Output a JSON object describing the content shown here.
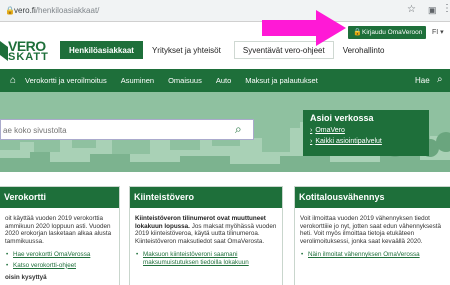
{
  "browser": {
    "url_host": "vero.fi",
    "url_path": "/henkiloasiakkaat/",
    "lock_icon": "lock-icon",
    "star_icon": "star-icon"
  },
  "header": {
    "logo_line1": "VERO",
    "logo_line2": "SKATT",
    "login_label": "Kirjaudu OmaVeroon",
    "lang_label": "FI",
    "topnav": [
      {
        "label": "Henkilöasiakkaat",
        "active": true
      },
      {
        "label": "Yritykset ja yhteisöt"
      },
      {
        "label": "Syventävät vero-ohjeet"
      },
      {
        "label": "Verohallinto"
      }
    ]
  },
  "mainnav": {
    "items": [
      "Verokortti ja veroilmoitus",
      "Asuminen",
      "Omaisuus",
      "Auto",
      "Maksut ja palautukset"
    ],
    "search_label": "Hae"
  },
  "hero": {
    "search_placeholder": "ae koko sivustolta",
    "asioi": {
      "title": "Asioi verkossa",
      "links": [
        "OmaVero",
        "Kaikki asiointipalvelut"
      ]
    }
  },
  "cards": [
    {
      "title": "Verokortti",
      "text": "oit käyttää vuoden 2019 verokorttia ammikuun 2020 loppuun asti. Vuoden 2020 erokorjan lasketaan alkaa alusta tammikuussa.",
      "links": [
        "Hae verokortti OmaVerossa",
        "Katso verokortti-ohjeet"
      ],
      "extra": "oisin kysyttyä"
    },
    {
      "title": "Kiinteistövero",
      "bold": "Kiinteistöveron tilinumerot ovat muuttuneet lokakuun lopussa.",
      "text": "Jos maksat myöhässä vuoden 2019 kiinteistöveroa, käytä uutta tilinumeroa. Kiinteistöveron maksutiedot saat OmaVerosta.",
      "links": [
        "Maksuon kiinteistöveroni saamani maksumuistutuksen tiedoilla lokakuun"
      ]
    },
    {
      "title": "Kotitalousvähennys",
      "text": "Voit ilmoittaa vuoden 2019 vähennyksen tiedot verokorttiiie jo nyt, jotten saat edun vähennyksestä heti. Voit myös ilmoittaa tietoja etukäteen verolimoituksessi, jonka saat kevaällä 2020.",
      "links": [
        "Näin ilmoitat vähennyksen OmaVerossa"
      ]
    }
  ],
  "colors": {
    "brand_green": "#1e6f3a",
    "arrow_magenta": "#ff19d6"
  }
}
